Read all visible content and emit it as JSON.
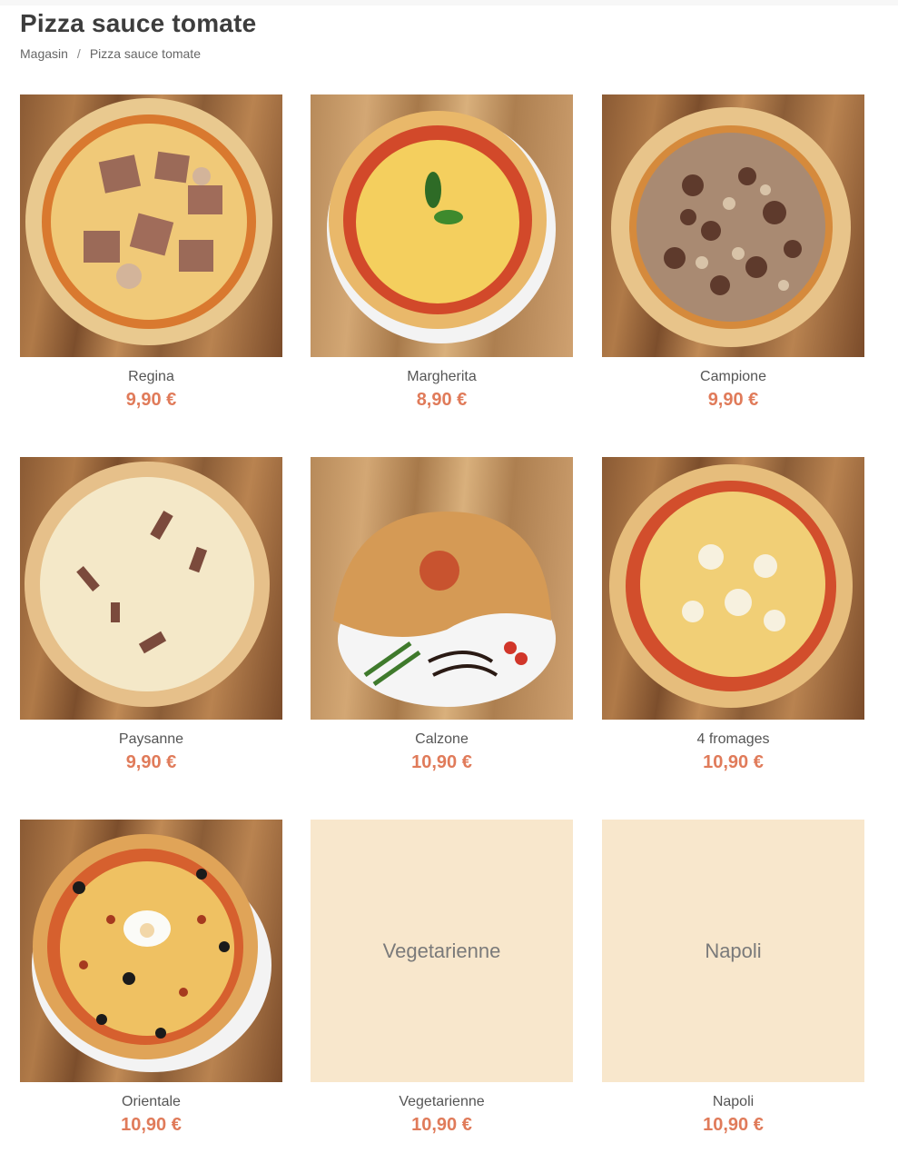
{
  "page": {
    "title": "Pizza sauce tomate",
    "breadcrumb": {
      "home": "Magasin",
      "separator": "/",
      "current": "Pizza sauce tomate"
    }
  },
  "colors": {
    "price": "#e07b5a",
    "placeholder_bg": "#f8e7cc"
  },
  "products": [
    {
      "name": "Regina",
      "price": "9,90 €",
      "image": "pizza-photo"
    },
    {
      "name": "Margherita",
      "price": "8,90 €",
      "image": "pizza-photo"
    },
    {
      "name": "Campione",
      "price": "9,90 €",
      "image": "pizza-photo"
    },
    {
      "name": "Paysanne",
      "price": "9,90 €",
      "image": "pizza-photo"
    },
    {
      "name": "Calzone",
      "price": "10,90 €",
      "image": "calzone-photo"
    },
    {
      "name": "4 fromages",
      "price": "10,90 €",
      "image": "pizza-photo"
    },
    {
      "name": "Orientale",
      "price": "10,90 €",
      "image": "pizza-photo"
    },
    {
      "name": "Vegetarienne",
      "price": "10,90 €",
      "image": "placeholder",
      "placeholder_text": "Vegetarienne"
    },
    {
      "name": "Napoli",
      "price": "10,90 €",
      "image": "placeholder",
      "placeholder_text": "Napoli"
    }
  ]
}
